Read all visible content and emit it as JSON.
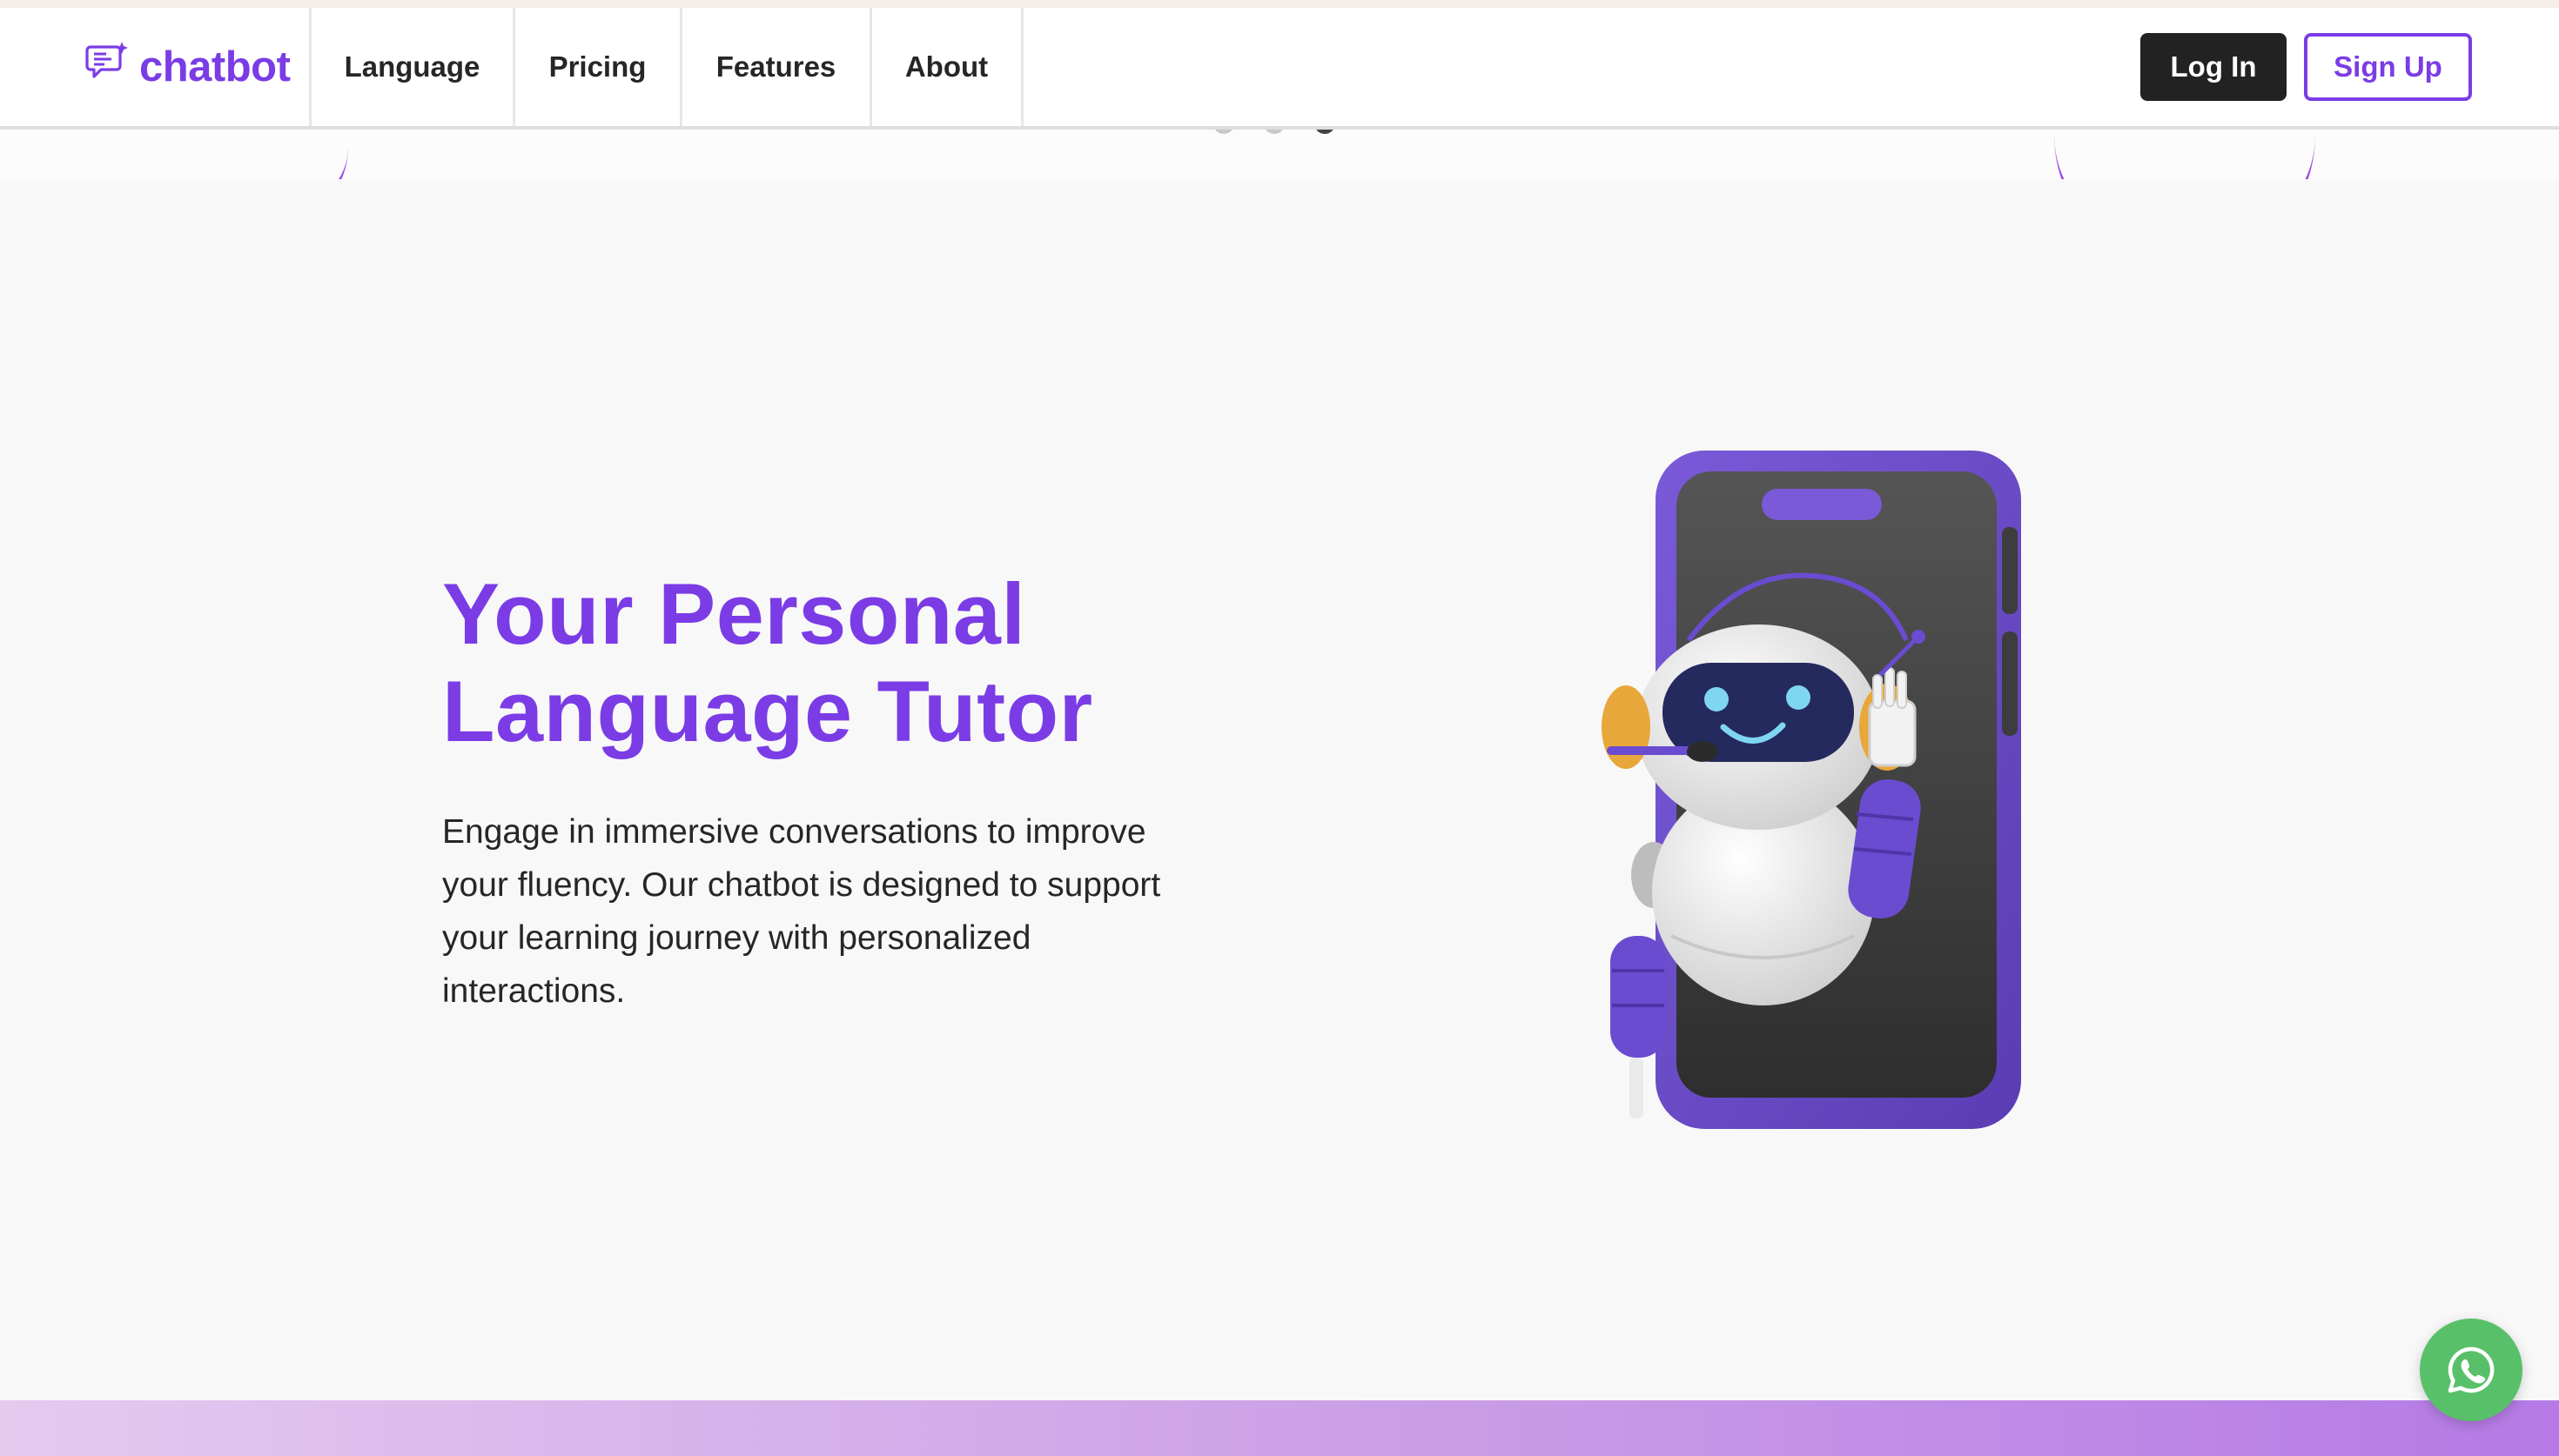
{
  "brand": {
    "name": "chatbot",
    "icon": "chat-sparkle-icon",
    "color": "#7b3ce6"
  },
  "nav": {
    "items": [
      {
        "label": "Language"
      },
      {
        "label": "Pricing"
      },
      {
        "label": "Features"
      },
      {
        "label": "About"
      }
    ]
  },
  "auth": {
    "login_label": "Log In",
    "signup_label": "Sign Up"
  },
  "carousel": {
    "dot_count": 3,
    "active_index": 2
  },
  "hero": {
    "title_line1": "Your Personal",
    "title_line2": "Language Tutor",
    "description": "Engage in immersive conversations to improve your fluency. Our chatbot is designed to support your learning journey with personalized interactions.",
    "illustration": "robot-phone-illustration"
  },
  "fab": {
    "icon": "whatsapp-icon",
    "color": "#59c06a"
  },
  "colors": {
    "accent": "#7b3ce6",
    "login_bg": "#222222",
    "page_bg": "#f8f8f8"
  }
}
